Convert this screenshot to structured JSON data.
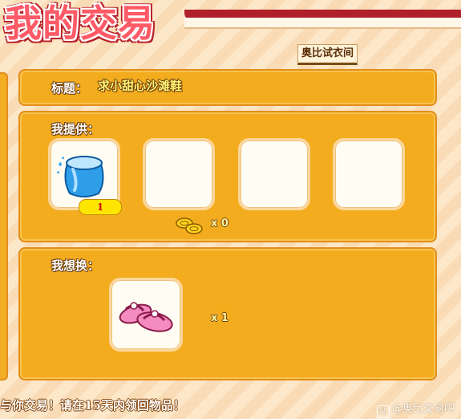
{
  "header": {
    "title": "我的交易",
    "store_tag": "奥比试衣间"
  },
  "title_panel": {
    "label": "标题：",
    "value": "求小甜心沙滩鞋"
  },
  "offer_panel": {
    "label": "我提供：",
    "slots": [
      {
        "item_icon": "blue-pillow-icon",
        "quantity": "1"
      },
      {
        "item_icon": "",
        "quantity": ""
      },
      {
        "item_icon": "",
        "quantity": ""
      },
      {
        "item_icon": "",
        "quantity": ""
      }
    ],
    "coin_icon": "gold-coins-icon",
    "coin_count": "x 0"
  },
  "want_panel": {
    "label": "我想换：",
    "item_icon": "pink-sandals-icon",
    "item_count": "x 1"
  },
  "footer": {
    "notice": "与你交易！请在15天内领回物品！",
    "watermark": "@奥比交易吧"
  },
  "colors": {
    "panel": "#f4ac1f",
    "panel_border": "#e38e1a",
    "title_red": "#ff5a66",
    "slot_bg": "#fffdf3",
    "badge_yellow": "#ffe600"
  }
}
